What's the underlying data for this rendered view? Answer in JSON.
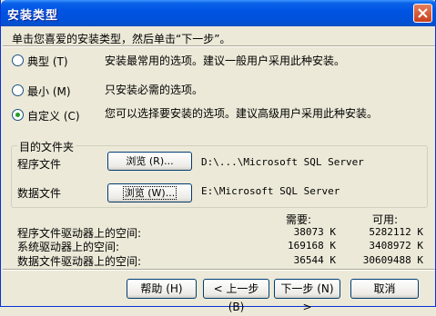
{
  "window": {
    "title": "安装类型"
  },
  "instruction": "单击您喜爱的安装类型，然后单击“下一步”。",
  "setup_types": [
    {
      "label": "典型 (T)",
      "description": "安装最常用的选项。建议一般用户采用此种安装。",
      "selected": false
    },
    {
      "label": "最小 (M)",
      "description": "只安装必需的选项。",
      "selected": false
    },
    {
      "label": "自定义 (C)",
      "description": "您可以选择要安装的选项。建议高级用户采用此种安装。",
      "selected": true
    }
  ],
  "destination": {
    "legend": "目的文件夹",
    "program_files": {
      "label": "程序文件",
      "browse_label": "浏览 (R)...",
      "path": "D:\\...\\Microsoft SQL Server"
    },
    "data_files": {
      "label": "数据文件",
      "browse_label": "浏览 (W)...",
      "path": "E:\\Microsoft SQL Server"
    }
  },
  "space": {
    "required_header": "需要:",
    "available_header": "可用:",
    "rows": [
      {
        "label": "程序文件驱动器上的空间:",
        "required": "38073 K",
        "available": "5282112 K"
      },
      {
        "label": "系统驱动器上的空间:",
        "required": "169168 K",
        "available": "3408972 K"
      },
      {
        "label": "数据文件驱动器上的空间:",
        "required": "36544 K",
        "available": "30609488 K"
      }
    ]
  },
  "buttons": {
    "help": "帮助 (H)",
    "back": "< 上一步 (B)",
    "next": "下一步 (N) >",
    "cancel": "取消"
  },
  "colors": {
    "titlebar": "#0054e3",
    "dialog_bg": "#ece9d8",
    "close": "#c8401c",
    "radio_dot": "#21a121"
  }
}
